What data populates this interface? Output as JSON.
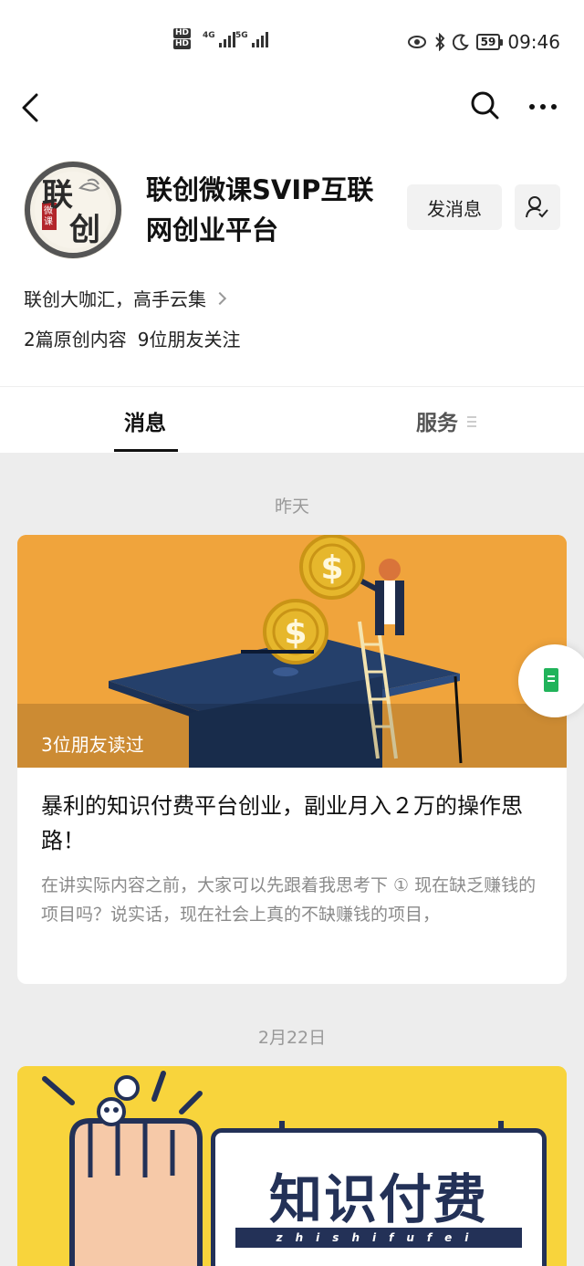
{
  "status_bar": {
    "sim1": "HD",
    "sim2": "HD",
    "net1": "4G",
    "net2": "5G",
    "battery": "59",
    "time": "09:46"
  },
  "profile": {
    "name": "联创微课SVIP互联网创业平台",
    "message_button": "发消息",
    "description": "联创大咖汇，高手云集",
    "original_count": "2篇原创内容",
    "friends_following": "9位朋友关注",
    "avatar_text_top": "联",
    "avatar_text_bottom": "创",
    "avatar_text_small": "微课"
  },
  "tabs": [
    {
      "label": "消息",
      "active": true
    },
    {
      "label": "服务",
      "active": false
    }
  ],
  "feed": {
    "date1": "昨天",
    "article1": {
      "readers": "3位朋友读过",
      "title": "暴利的知识付费平台创业，副业月入２万的操作思路！",
      "summary": "在讲实际内容之前，大家可以先跟着我思考下 ① 现在缺乏赚钱的项目吗？说实话，现在社会上真的不缺赚钱的项目，"
    },
    "date2": "2月22日",
    "article2": {
      "cover_title": "知识付费",
      "cover_subtitle": "zhishifufei"
    }
  },
  "colors": {
    "accent_green": "#21b35a",
    "cover_orange": "#f0a43c",
    "cover_yellow": "#f8d43c",
    "navy": "#233157"
  }
}
